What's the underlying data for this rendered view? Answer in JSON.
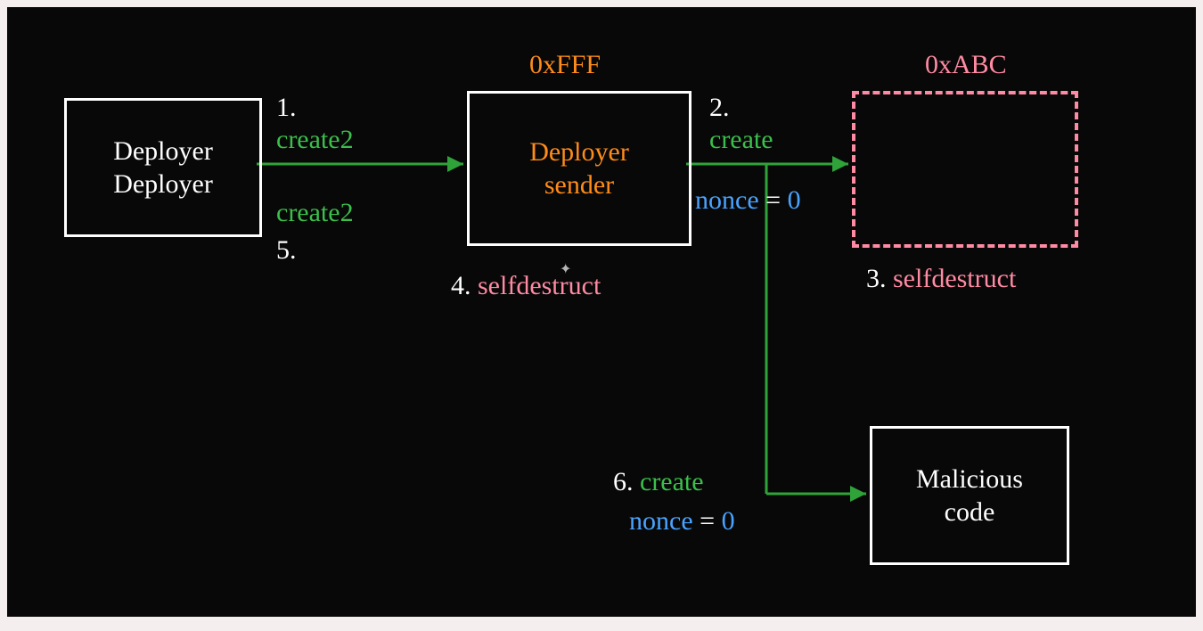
{
  "boxes": {
    "deployerDeployer": {
      "line1": "Deployer",
      "line2": "Deployer"
    },
    "deployerSender": {
      "line1": "Deployer",
      "line2": "sender",
      "address": "0xFFF"
    },
    "target": {
      "address": "0xABC"
    },
    "malicious": {
      "line1": "Malicious",
      "line2": "code"
    }
  },
  "steps": {
    "s1": {
      "num": "1.",
      "op": "create2"
    },
    "s2": {
      "num": "2.",
      "op": "create",
      "nonceLabel": "nonce",
      "eq": "=",
      "nonceValue": "0"
    },
    "s3": {
      "num": "3.",
      "op": "selfdestruct"
    },
    "s4": {
      "num": "4.",
      "op": "selfdestruct"
    },
    "s5": {
      "num": "5.",
      "op": "create2"
    },
    "s6": {
      "num": "6.",
      "op": "create",
      "nonceLabel": "nonce",
      "eq": "=",
      "nonceValue": "0"
    }
  }
}
